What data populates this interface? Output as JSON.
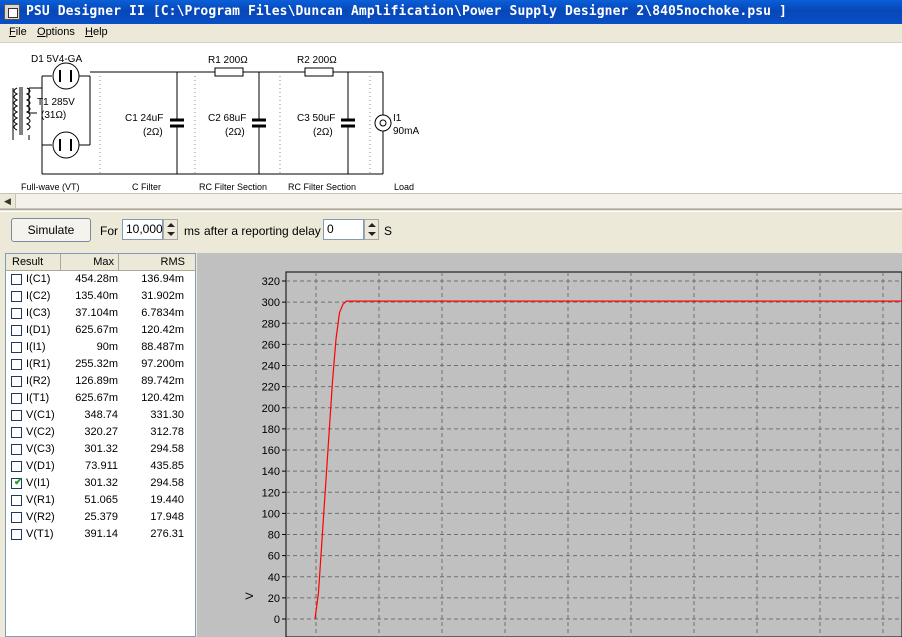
{
  "window": {
    "title": "PSU Designer II  [C:\\Program Files\\Duncan Amplification\\Power Supply Designer 2\\8405nochoke.psu ]",
    "icon": "app-icon"
  },
  "menu": [
    {
      "accel": "F",
      "rest": "ile"
    },
    {
      "accel": "O",
      "rest": "ptions"
    },
    {
      "accel": "H",
      "rest": "elp"
    }
  ],
  "schematic": {
    "rectifier": "D1 5V4-GA",
    "transformer_name": "T1 285V",
    "transformer_res": "(31Ω)",
    "c1_name": "C1 24uF",
    "c1_esr": "(2Ω)",
    "r1": "R1 200Ω",
    "c2_name": "C2 68uF",
    "c2_esr": "(2Ω)",
    "r2": "R2 200Ω",
    "c3_name": "C3 50uF",
    "c3_esr": "(2Ω)",
    "load_name": "I1",
    "load_value": "90mA",
    "sections": [
      "Full-wave (VT)",
      "C Filter",
      "RC Filter Section",
      "RC Filter Section",
      "Load"
    ]
  },
  "toolbar": {
    "simulate": "Simulate",
    "for": "For",
    "duration": "10,000",
    "ms": "ms",
    "after_text": "after a reporting delay of",
    "delay": "0",
    "s": "S"
  },
  "results": {
    "headers": [
      "Result",
      "Max",
      "RMS"
    ],
    "rows": [
      {
        "name": "I(C1)",
        "max": "454.28m",
        "rms": "136.94m",
        "checked": false
      },
      {
        "name": "I(C2)",
        "max": "135.40m",
        "rms": "31.902m",
        "checked": false
      },
      {
        "name": "I(C3)",
        "max": "37.104m",
        "rms": "6.7834m",
        "checked": false
      },
      {
        "name": "I(D1)",
        "max": "625.67m",
        "rms": "120.42m",
        "checked": false
      },
      {
        "name": "I(I1)",
        "max": "90m",
        "rms": "88.487m",
        "checked": false
      },
      {
        "name": "I(R1)",
        "max": "255.32m",
        "rms": "97.200m",
        "checked": false
      },
      {
        "name": "I(R2)",
        "max": "126.89m",
        "rms": "89.742m",
        "checked": false
      },
      {
        "name": "I(T1)",
        "max": "625.67m",
        "rms": "120.42m",
        "checked": false
      },
      {
        "name": "V(C1)",
        "max": "348.74",
        "rms": "331.30",
        "checked": false
      },
      {
        "name": "V(C2)",
        "max": "320.27",
        "rms": "312.78",
        "checked": false
      },
      {
        "name": "V(C3)",
        "max": "301.32",
        "rms": "294.58",
        "checked": false
      },
      {
        "name": "V(D1)",
        "max": "73.911",
        "rms": "435.85",
        "checked": false
      },
      {
        "name": "V(I1)",
        "max": "301.32",
        "rms": "294.58",
        "checked": true
      },
      {
        "name": "V(R1)",
        "max": "51.065",
        "rms": "19.440",
        "checked": false
      },
      {
        "name": "V(R2)",
        "max": "25.379",
        "rms": "17.948",
        "checked": false
      },
      {
        "name": "V(T1)",
        "max": "391.14",
        "rms": "276.31",
        "checked": false
      }
    ]
  },
  "chart_data": {
    "type": "line",
    "ylabel": "V",
    "ylim": [
      0,
      320
    ],
    "yticks": [
      "320",
      "300",
      "280",
      "260",
      "240",
      "220",
      "200",
      "180",
      "160",
      "140",
      "120",
      "100",
      "80",
      "60",
      "40",
      "20",
      "0"
    ],
    "grid": true,
    "series": [
      {
        "values": [
          0,
          25,
          75,
          125,
          175,
          225,
          265,
          290,
          298,
          301,
          301,
          301,
          301,
          301,
          301,
          301,
          301,
          301,
          301,
          301,
          301
        ]
      }
    ],
    "colors": {
      "line": "#ff0000",
      "background": "#c0c0c0",
      "grid": "#707070"
    }
  }
}
